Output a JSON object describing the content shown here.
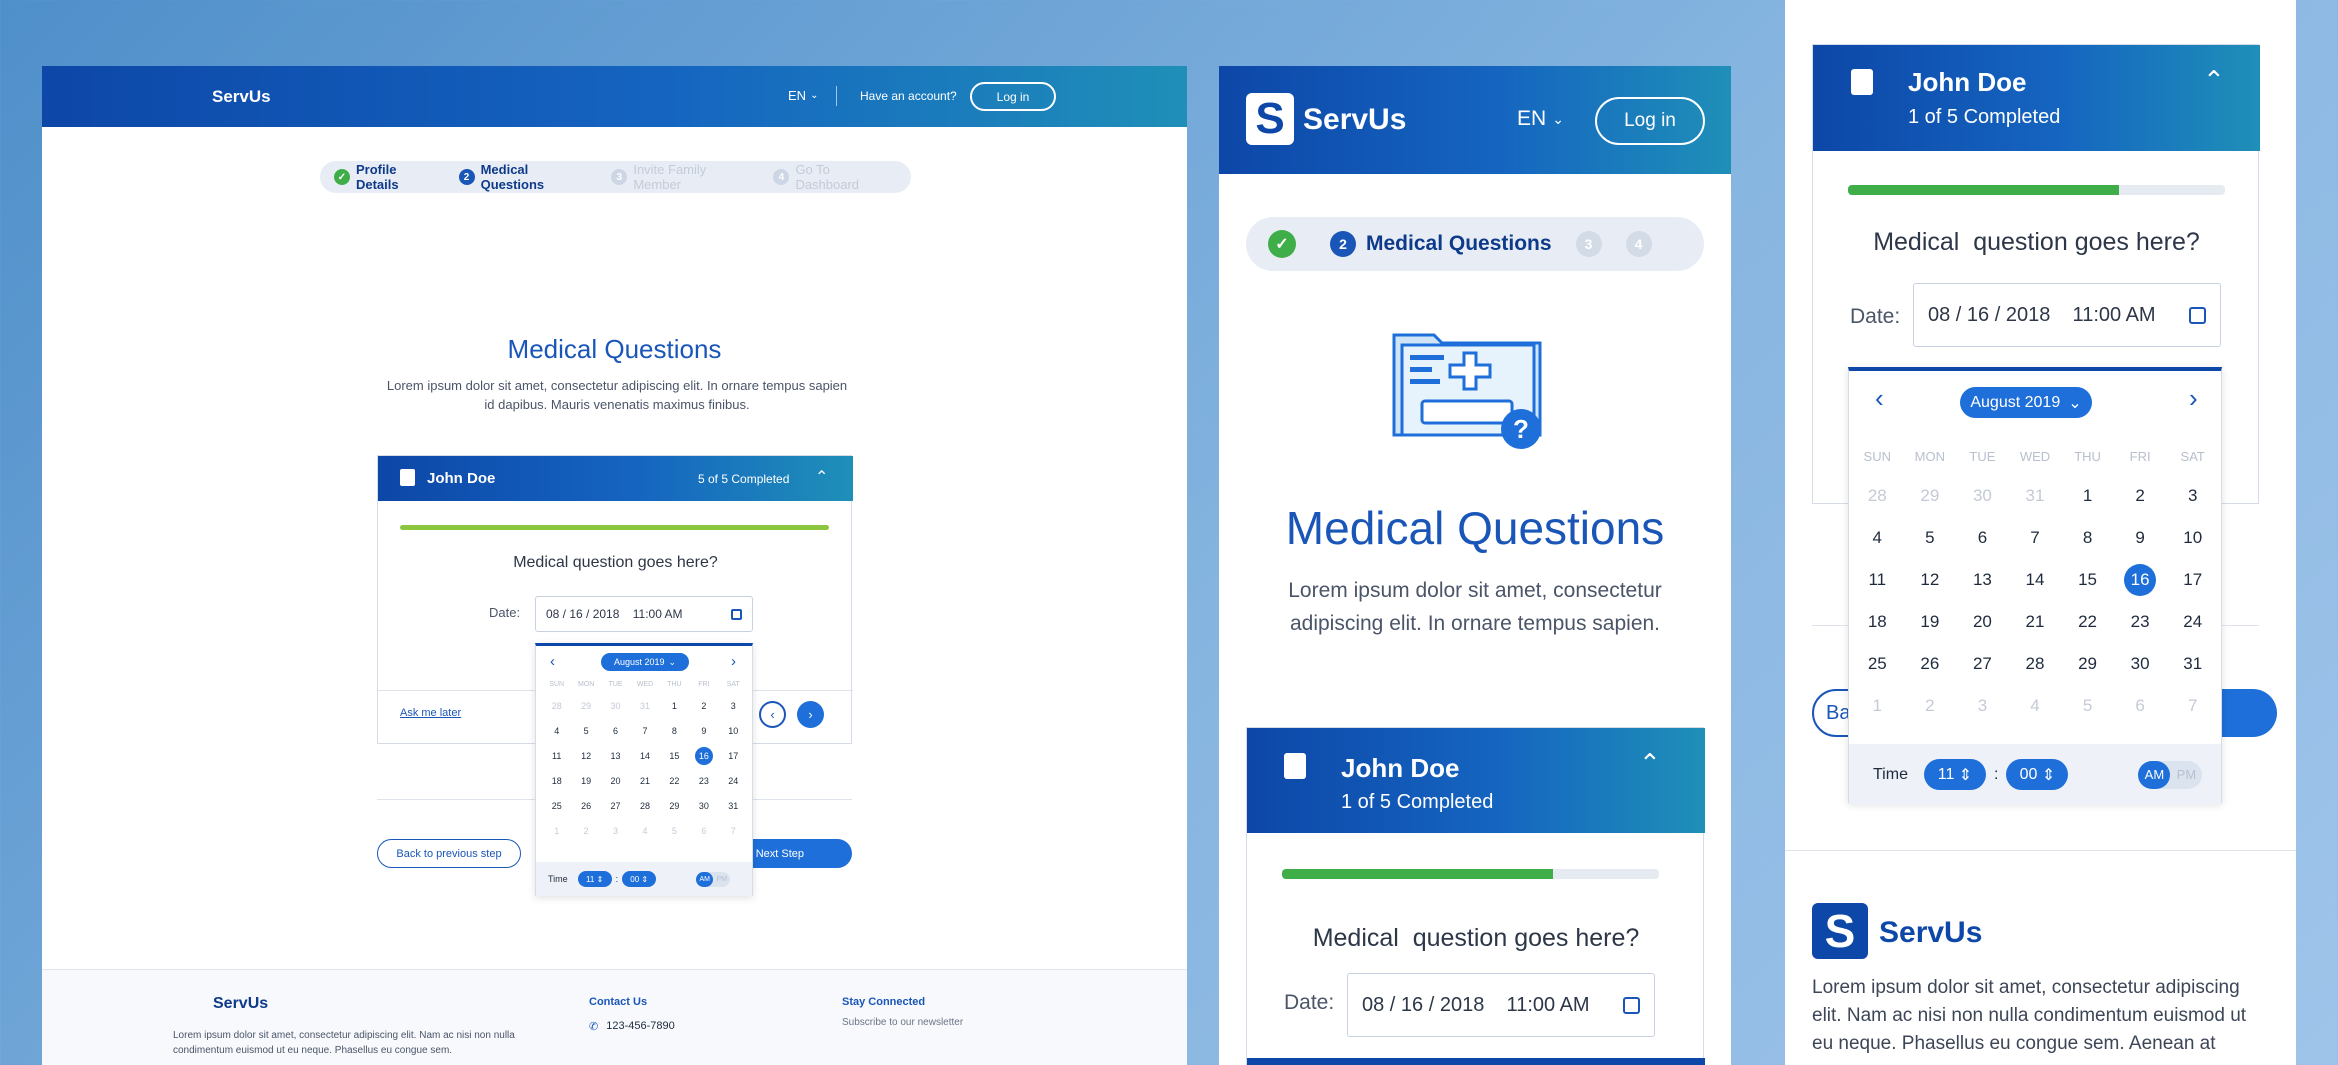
{
  "brand": "ServUs",
  "header": {
    "lang": "EN",
    "have_account": "Have an account?",
    "login": "Log in"
  },
  "stepper": {
    "steps": [
      {
        "n": "1",
        "label": "Profile Details",
        "state": "done"
      },
      {
        "n": "2",
        "label": "Medical Questions",
        "state": "active"
      },
      {
        "n": "3",
        "label": "Invite Family Member",
        "state": "todo"
      },
      {
        "n": "4",
        "label": "Go To Dashboard",
        "state": "todo"
      }
    ]
  },
  "page": {
    "title": "Medical Questions",
    "desc_desktop": "Lorem ipsum dolor sit amet, consectetur adipiscing elit. In ornare tempus sapien id dapibus. Mauris venenatis maximus finibus.",
    "desc_mobile": "Lorem ipsum dolor sit amet, consectetur adipiscing elit. In ornare tempus sapien."
  },
  "card": {
    "name": "John Doe",
    "completed_desktop": "5 of 5 Completed",
    "completed_mobile": "1 of 5 Completed",
    "progress_desktop": 1.0,
    "progress_mobile": 0.72,
    "question_desktop": "Medical question goes here?",
    "question_mobile": "Medical  question goes here?",
    "date_label": "Date:",
    "date_value": "08 / 16 / 2018    11:00 AM",
    "ask_later": "Ask me later"
  },
  "calendar": {
    "month": "August 2019",
    "weekdays": [
      "SUN",
      "MON",
      "TUE",
      "WED",
      "THU",
      "FRI",
      "SAT"
    ],
    "days": [
      [
        "28",
        "29",
        "30",
        "31",
        "1",
        "2",
        "3"
      ],
      [
        "4",
        "5",
        "6",
        "7",
        "8",
        "9",
        "10"
      ],
      [
        "11",
        "12",
        "13",
        "14",
        "15",
        "16",
        "17"
      ],
      [
        "18",
        "19",
        "20",
        "21",
        "22",
        "23",
        "24"
      ],
      [
        "25",
        "26",
        "27",
        "28",
        "29",
        "30",
        "31"
      ],
      [
        "1",
        "2",
        "3",
        "4",
        "5",
        "6",
        "7"
      ]
    ],
    "selected": "16",
    "time_label": "Time",
    "hour": "11",
    "minute": "00",
    "am": "AM",
    "pm": "PM"
  },
  "nav": {
    "back": "Back to previous step",
    "next": "Next Step",
    "back_short": "Ba"
  },
  "footer": {
    "brand": "ServUs",
    "about": "Lorem ipsum dolor sit amet, consectetur adipiscing elit. Nam ac nisi non nulla condimentum euismod ut eu neque. Phasellus eu congue sem.",
    "about_mobile": "Lorem ipsum dolor sit amet, consectetur adipiscing elit. Nam ac nisi non nulla condimentum euismod ut eu neque. Phasellus eu congue sem. Aenean at lacinia",
    "contact_title": "Contact Us",
    "phone": "123-456-7890",
    "stay_title": "Stay Connected",
    "newsletter": "Subscribe to our newsletter"
  },
  "colors": {
    "primary": "#1a56b8",
    "success": "#3fae49",
    "accent": "#1e6fd9"
  }
}
